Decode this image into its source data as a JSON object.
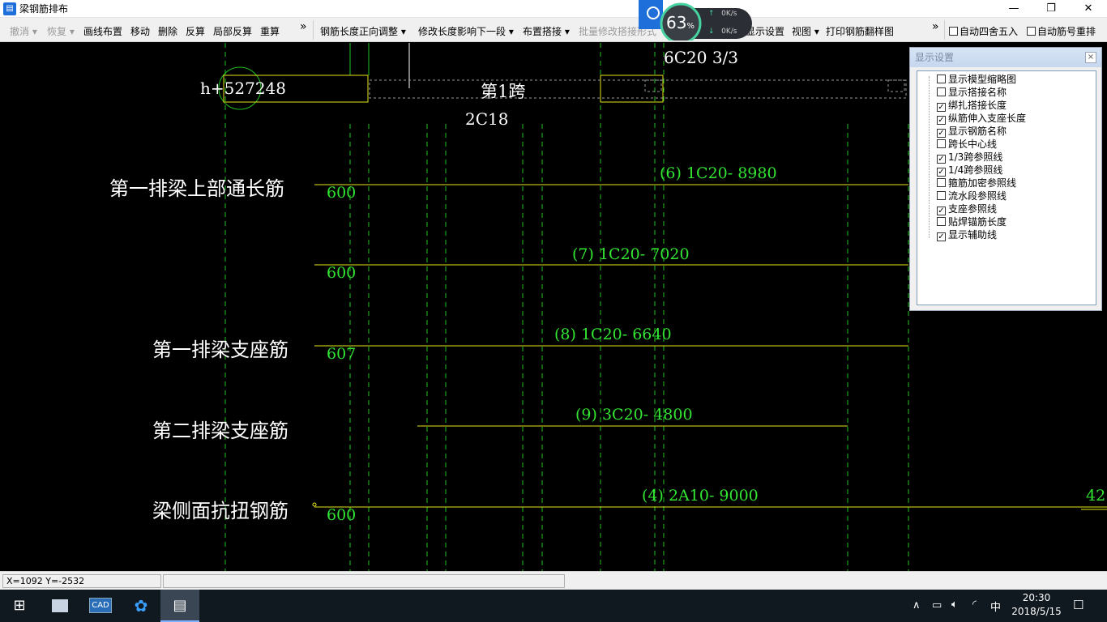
{
  "window": {
    "title": "梁钢筋排布",
    "minimize": "—",
    "maximize": "❐",
    "close": "✕"
  },
  "toolbar": {
    "undo": "撤消",
    "redo": "恢复",
    "draw_layout": "画线布置",
    "move": "移动",
    "delete": "删除",
    "reverse": "反算",
    "partial_reverse": "局部反算",
    "recalc": "重算",
    "more1": "»",
    "length_adjust": "钢筋长度正向调整",
    "modify_next": "修改长度影响下一段",
    "lap_layout": "布置搭接",
    "batch_modify": "批量修改搭接形式",
    "display_settings": "显示设置",
    "view": "视图",
    "print_rebar": "打印钢筋翻样图",
    "more2": "»",
    "auto_round": "自动四舍五入",
    "auto_renumber": "自动筋号重排"
  },
  "overlay": {
    "percent": "63",
    "unit": "%",
    "up_speed": "0",
    "down_speed": "0",
    "speed_unit": "K/s"
  },
  "canvas": {
    "top_coord": "h+527248",
    "span_label": "第1跨",
    "top_rebar": "6C20 3/3",
    "stirrup_label": "2C18",
    "rows": [
      {
        "name": "第一排梁上部通长筋",
        "rebar": "(6) 1C20- 8980",
        "length": "600"
      },
      {
        "name": "",
        "rebar": "(7) 1C20- 7020",
        "length": "600"
      },
      {
        "name": "第一排梁支座筋",
        "rebar": "(8) 1C20- 6640",
        "length": "607"
      },
      {
        "name": "第二排梁支座筋",
        "rebar": "(9) 3C20- 4800",
        "length": ""
      },
      {
        "name": "梁侧面抗扭钢筋",
        "rebar": "(4) 2A10- 9000",
        "length": "600"
      }
    ],
    "right_edge_value": "42"
  },
  "settings_panel": {
    "title": "显示设置",
    "close": "×",
    "options": [
      {
        "label": "显示模型缩略图",
        "checked": false
      },
      {
        "label": "显示搭接名称",
        "checked": false
      },
      {
        "label": "绑扎搭接长度",
        "checked": true
      },
      {
        "label": "纵筋伸入支座长度",
        "checked": true
      },
      {
        "label": "显示钢筋名称",
        "checked": true
      },
      {
        "label": "跨长中心线",
        "checked": false
      },
      {
        "label": "1/3跨参照线",
        "checked": true
      },
      {
        "label": "1/4跨参照线",
        "checked": true
      },
      {
        "label": "箍筋加密参照线",
        "checked": false
      },
      {
        "label": "流水段参照线",
        "checked": false
      },
      {
        "label": "支座参照线",
        "checked": true
      },
      {
        "label": "贴焊锚筋长度",
        "checked": false
      },
      {
        "label": "显示辅助线",
        "checked": true
      }
    ]
  },
  "status": {
    "coords": "X=1092 Y=-2532"
  },
  "taskbar": {
    "start": "⊞",
    "app2": "CAD",
    "app3": "✿",
    "app4": "▤",
    "time": "20:30",
    "date": "2018/5/15",
    "ime": "中",
    "tray_up": "∧",
    "notify": "☐"
  }
}
